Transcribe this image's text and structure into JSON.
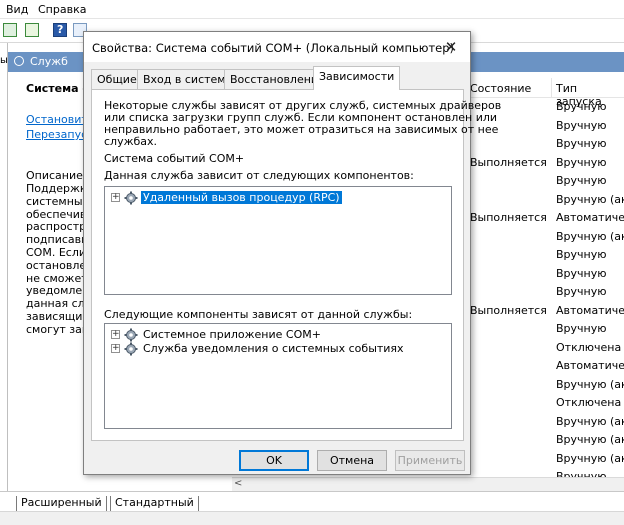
{
  "menu": {
    "view": "Вид",
    "help": "Справка"
  },
  "services_header": {
    "title": "Служб"
  },
  "left_pane": {
    "title": "Система соб",
    "stop_link": "Остановить",
    "restart_link": "Перезапуст",
    "description_label": "Описание:",
    "description_lines": [
      "Поддержка с",
      "системных с",
      "обеспечива",
      "распростран",
      "подписавши",
      "COM. Если д",
      "остановлена",
      "не сможет п",
      "уведомлени",
      "данная служ",
      "зависящие с",
      "смогут запу"
    ]
  },
  "columns": {
    "status": "Состояние",
    "startup": "Тип запуска"
  },
  "rows": [
    {
      "status": "",
      "startup": "Вручную"
    },
    {
      "status": "",
      "startup": "Вручную"
    },
    {
      "status": "",
      "startup": "Вручную"
    },
    {
      "status": "Выполняется",
      "startup": "Вручную"
    },
    {
      "status": "",
      "startup": "Вручную"
    },
    {
      "status": "",
      "startup": "Вручную (ак."
    },
    {
      "status": "Выполняется",
      "startup": "Автоматиче.."
    },
    {
      "status": "",
      "startup": "Вручную (ак."
    },
    {
      "status": "",
      "startup": "Вручную"
    },
    {
      "status": "",
      "startup": "Вручную"
    },
    {
      "status": "",
      "startup": "Вручную"
    },
    {
      "status": "Выполняется",
      "startup": "Автоматиче.."
    },
    {
      "status": "",
      "startup": "Вручную"
    },
    {
      "status": "",
      "startup": "Отключена"
    },
    {
      "status": "",
      "startup": "Автоматиче.."
    },
    {
      "status": "",
      "startup": "Вручную (ак."
    },
    {
      "status": "",
      "startup": "Отключена"
    },
    {
      "status": "",
      "startup": "Вручную (ак."
    },
    {
      "status": "",
      "startup": "Вручную (ак."
    },
    {
      "status": "",
      "startup": "Вручную (ак."
    },
    {
      "status": "",
      "startup": "Вручную"
    }
  ],
  "bottom_tabs": {
    "extended": "Расширенный",
    "standard": "Стандартный"
  },
  "dialog": {
    "title": "Свойства: Система событий COM+ (Локальный компьютер)",
    "close_glyph": "✕",
    "tabs": [
      "Общие",
      "Вход в систему",
      "Восстановление",
      "Зависимости"
    ],
    "active_tab": "Зависимости",
    "info_lines": [
      "Некоторые службы зависят от других служб, системных драйверов",
      "или списка загрузки групп служб. Если компонент остановлен или",
      "неправильно работает, это может отразиться на зависимых от нее",
      "службах."
    ],
    "service_name": "Система событий COM+",
    "depends_on_label": "Данная служба зависит от следующих компонентов:",
    "depends_on": [
      "Удаленный вызов процедур (RPC)"
    ],
    "dependents_label": "Следующие компоненты зависят от данной службы:",
    "dependents": [
      "Системное приложение COM+",
      "Служба уведомления о системных событиях"
    ],
    "buttons": {
      "ok": "OK",
      "cancel": "Отмена",
      "apply": "Применить"
    }
  },
  "colors": {
    "header_blue": "#6b93c4",
    "selection": "#0078d7",
    "link": "#0066cc"
  }
}
